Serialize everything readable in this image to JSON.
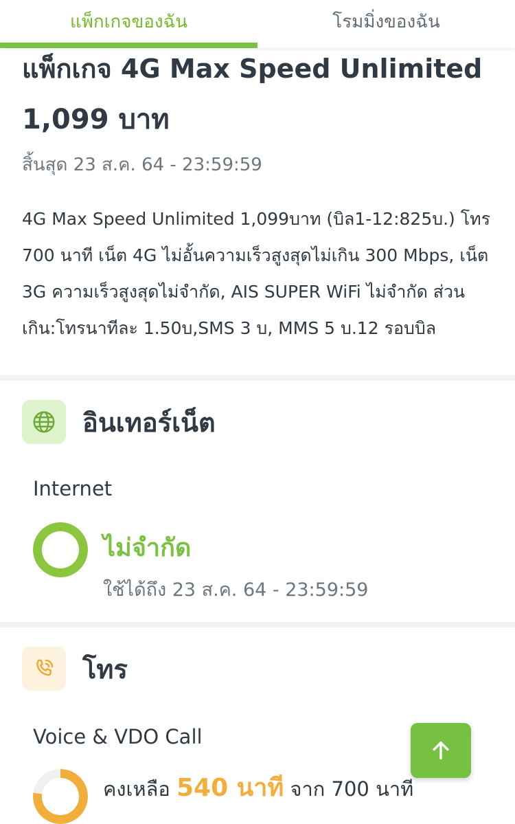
{
  "tabs": [
    {
      "label": "แพ็กเกจของฉัน",
      "active": true
    },
    {
      "label": "โรมมิ่งของฉัน",
      "active": false
    }
  ],
  "package": {
    "title": "แพ็กเกจ 4G Max Speed Unlimited",
    "price": "1,099 บาท",
    "expire": "สิ้นสุด 23 ส.ค. 64 - 23:59:59",
    "description_lines": [
      "4G Max Speed Unlimited 1,099บาท (บิล1-12:825บ.) โทร",
      "700 นาที เน็ต 4G ไม่อั้นความเร็วสูงสุดไม่เกิน 300 Mbps, เน็ต",
      "3G ความเร็วสูงสุดไม่จำกัด, AIS SUPER WiFi ไม่จำกัด ส่วน",
      "เกิน:โทรนาทีละ 1.50บ,SMS 3 บ, MMS 5 บ.12 รอบบิล"
    ]
  },
  "internet": {
    "section_title": "อินเทอร์เน็ต",
    "icon": "globe-icon",
    "item_label": "Internet",
    "status": "ไม่จำกัด",
    "valid_until": "ใช้ได้ถึง 23 ส.ค. 64 - 23:59:59",
    "remaining_fraction": 1.0
  },
  "call": {
    "section_title": "โทร",
    "icon": "phone-call-icon",
    "item_label": "Voice & VDO Call",
    "remaining_prefix": "คงเหลือ",
    "remaining_value": "540 นาที",
    "remaining_suffix": "จาก 700 นาที",
    "remaining_fraction": 0.771
  },
  "fab": {
    "icon": "arrow-up-icon"
  },
  "colors": {
    "accent_green": "#7cc242",
    "accent_orange": "#f2ae3b",
    "text_dark": "#2f3a44",
    "text_muted": "#6d7780"
  }
}
